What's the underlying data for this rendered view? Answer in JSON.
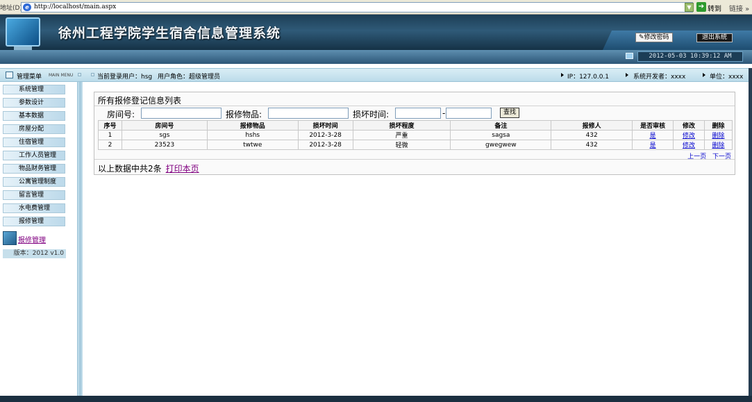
{
  "browser": {
    "address_label": "地址(D)",
    "url": "http://localhost/main.aspx",
    "go_label": "转到",
    "links_label": "链接 »"
  },
  "header": {
    "title": "徐州工程学院学生宿舍信息管理系统",
    "change_password": "修改密码",
    "logout": "退出系统",
    "datetime": "2012-05-03 10:39:12 AM"
  },
  "infobar": {
    "menu_label": "管理菜单",
    "menu_en": "MAIN MENU",
    "current_user": "当前登录用户：hsg",
    "user_role": "用户角色：超级管理员",
    "ip": "IP：127.0.0.1",
    "developer": "系统开发者：xxxx",
    "unit": "单位：xxxx"
  },
  "sidebar": {
    "items": [
      {
        "label": "系统管理"
      },
      {
        "label": "参数设计"
      },
      {
        "label": "基本数据"
      },
      {
        "label": "房屋分配"
      },
      {
        "label": "住宿管理"
      },
      {
        "label": "工作人员管理"
      },
      {
        "label": "物品财务管理"
      },
      {
        "label": "公寓管理制度"
      },
      {
        "label": "留言管理"
      },
      {
        "label": "水电费管理"
      },
      {
        "label": "报修管理"
      }
    ],
    "active_item": "报修管理",
    "version": "版本：2012 v1.0"
  },
  "main": {
    "panel_title": "所有报修登记信息列表",
    "search": {
      "room_label": "房间号:",
      "item_label": "报修物品:",
      "time_label": "损坏时间:",
      "dash": "-",
      "search_button": "查找"
    },
    "table": {
      "columns": [
        "序号",
        "房间号",
        "报修物品",
        "损坏时间",
        "损坏程度",
        "备注",
        "报修人",
        "是否审核",
        "修改",
        "删除"
      ],
      "rows": [
        {
          "seq": "1",
          "room": "sgs",
          "item": "hshs",
          "time": "2012-3-28",
          "degree": "严重",
          "note": "sagsa",
          "reporter": "432",
          "audited": "是",
          "edit": "修改",
          "delete": "删除"
        },
        {
          "seq": "2",
          "room": "23523",
          "item": "twtwe",
          "time": "2012-3-28",
          "degree": "轻微",
          "note": "gwegwew",
          "reporter": "432",
          "audited": "是",
          "edit": "修改",
          "delete": "删除"
        }
      ]
    },
    "pager": {
      "prev": "上一页",
      "next": "下一页"
    },
    "footer_text": "以上数据中共2条",
    "print_link": "打印本页"
  }
}
